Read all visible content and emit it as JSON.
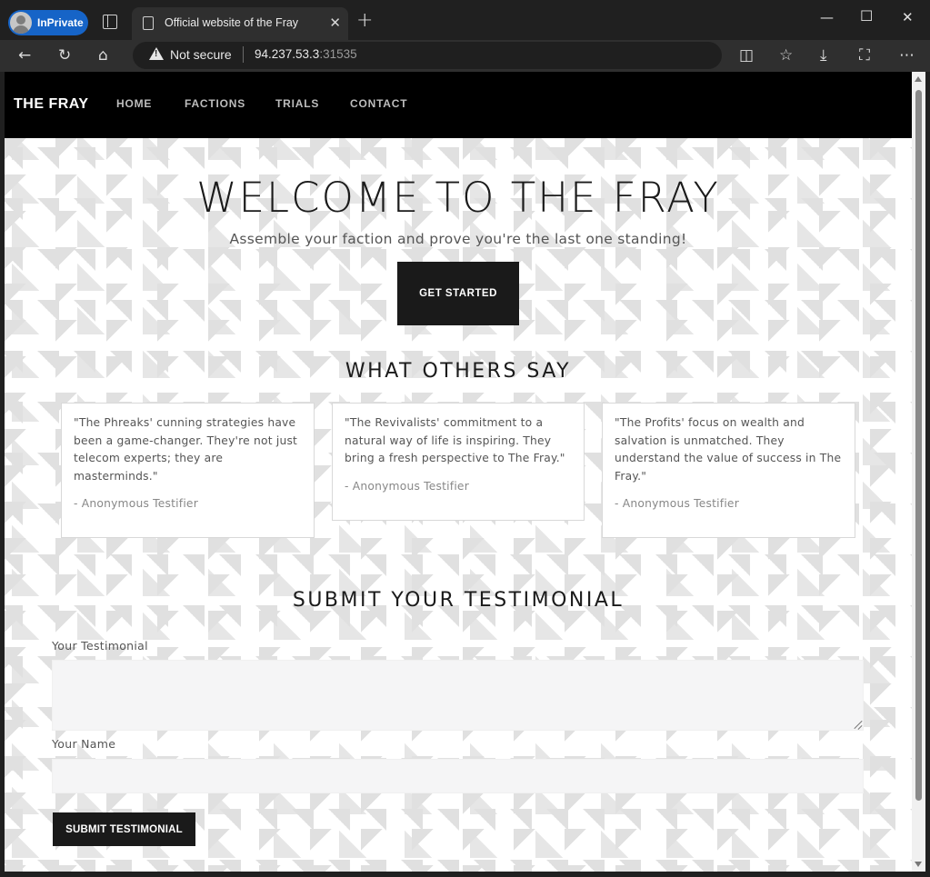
{
  "browser": {
    "profile_label": "InPrivate",
    "tab_title": "Official website of the Fray",
    "security_label": "Not secure",
    "url_host": "94.237.53.3",
    "url_port": ":31535"
  },
  "nav": {
    "brand": "THE FRAY",
    "links": [
      "HOME",
      "FACTIONS",
      "TRIALS",
      "CONTACT"
    ]
  },
  "hero": {
    "title": "WELCOME TO THE FRAY",
    "subtitle": "Assemble your faction and prove you're the last one standing!",
    "cta": "GET STARTED"
  },
  "testimonials": {
    "title": "WHAT OTHERS SAY",
    "items": [
      {
        "quote": "\"The Phreaks' cunning strategies have been a game-changer. They're not just telecom experts; they are masterminds.\"",
        "author": "- Anonymous Testifier"
      },
      {
        "quote": "\"The Revivalists' commitment to a natural way of life is inspiring. They bring a fresh perspective to The Fray.\"",
        "author": "- Anonymous Testifier"
      },
      {
        "quote": "\"The Profits' focus on wealth and salvation is unmatched. They understand the value of success in The Fray.\"",
        "author": "- Anonymous Testifier"
      }
    ]
  },
  "form": {
    "title": "SUBMIT YOUR TESTIMONIAL",
    "testimonial_label": "Your Testimonial",
    "testimonial_value": "",
    "name_label": "Your Name",
    "name_value": "",
    "submit_label": "SUBMIT TESTIMONIAL"
  }
}
